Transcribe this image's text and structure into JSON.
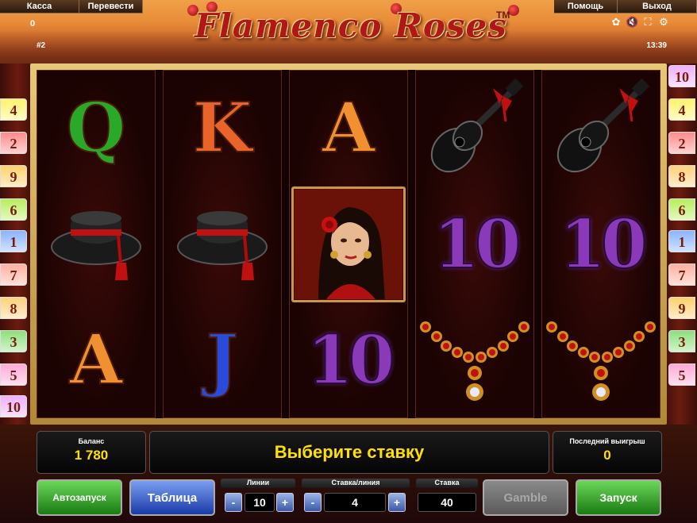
{
  "header": {
    "menu_left": [
      "Касса",
      "Перевести"
    ],
    "menu_right": [
      "Помощь",
      "Выход"
    ],
    "credit_counter": "0",
    "game_number": "#2",
    "clock": "13:39",
    "logo": "Flamenco Roses",
    "trademark": "TM",
    "icons": [
      "rose-icon",
      "sound-off-icon",
      "fullscreen-icon",
      "settings-icon"
    ]
  },
  "paylines": {
    "left": [
      {
        "label": "4",
        "color": "#fff36a"
      },
      {
        "label": "2",
        "color": "#ff8a8a"
      },
      {
        "label": "9",
        "color": "#ffd06a"
      },
      {
        "label": "6",
        "color": "#b6ee5a"
      },
      {
        "label": "1",
        "color": "#8ab4ff"
      },
      {
        "label": "7",
        "color": "#ffb0a0"
      },
      {
        "label": "8",
        "color": "#ffd07a"
      },
      {
        "label": "3",
        "color": "#8ce07a"
      },
      {
        "label": "5",
        "color": "#ffaad8"
      },
      {
        "label": "10",
        "color": "#f0b0ff"
      }
    ],
    "right": [
      {
        "label": "10",
        "color": "#f0b0ff"
      },
      {
        "label": "4",
        "color": "#fff36a"
      },
      {
        "label": "2",
        "color": "#ff8a8a"
      },
      {
        "label": "8",
        "color": "#ffd07a"
      },
      {
        "label": "6",
        "color": "#b6ee5a"
      },
      {
        "label": "1",
        "color": "#8ab4ff"
      },
      {
        "label": "7",
        "color": "#ffb0a0"
      },
      {
        "label": "9",
        "color": "#ffd06a"
      },
      {
        "label": "3",
        "color": "#8ce07a"
      },
      {
        "label": "5",
        "color": "#ffaad8"
      }
    ]
  },
  "reels": [
    [
      "Q",
      "hat",
      "A"
    ],
    [
      "K",
      "hat",
      "J"
    ],
    [
      "A",
      "flamenca",
      "10"
    ],
    [
      "guitar",
      "10",
      "necklace"
    ],
    [
      "guitar",
      "10",
      "necklace"
    ]
  ],
  "symbol_colors": {
    "Q": "#2aa82a",
    "K": "#e8642a",
    "A": "#f09030",
    "J": "#2a4ad8",
    "10": "#8a3ab8"
  },
  "panel": {
    "balance_label": "Баланс",
    "balance_value": "1 780",
    "message": "Выберите ставку",
    "last_win_label": "Последний выигрыш",
    "last_win_value": "0",
    "lines_label": "Линии",
    "lines_value": "10",
    "bet_per_line_label": "Ставка/линия",
    "bet_per_line_value": "4",
    "bet_label": "Ставка",
    "bet_value": "40",
    "minus": "-",
    "plus": "+",
    "autostart": "Автозапуск",
    "paytable": "Таблица",
    "gamble": "Gamble",
    "spin": "Запуск"
  }
}
